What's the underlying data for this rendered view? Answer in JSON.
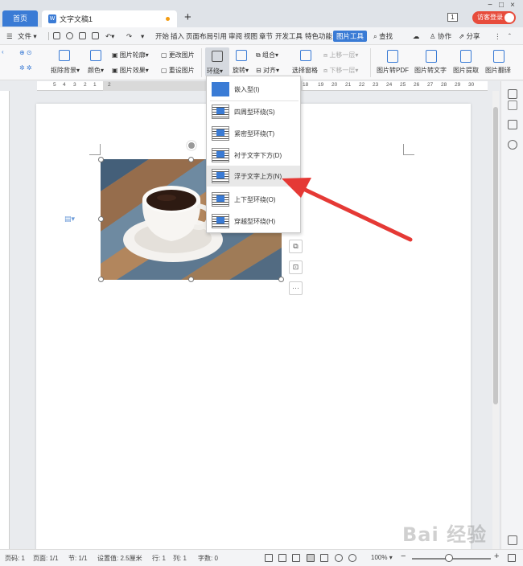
{
  "titlebar": {
    "home_tab": "首页",
    "doc_tab": "文字文稿1",
    "add_tab": "+",
    "page_count": "1",
    "login": "访客登录",
    "win_controls": [
      "−",
      "□",
      "×"
    ]
  },
  "menubar": {
    "file": "文件",
    "items": [
      "开始",
      "插入",
      "页面布局",
      "引用",
      "审阅",
      "视图",
      "章节",
      "开发工具",
      "特色功能"
    ],
    "active": "图片工具",
    "search": "查找",
    "collab": "协作",
    "share": "分享"
  },
  "ribbon": {
    "remove_bg": "抠除背景",
    "color": "颜色",
    "pic_outline": "图片轮廓",
    "pic_effect": "图片效果",
    "change_pic": "更改图片",
    "reset_pic": "重设图片",
    "wrap": "环绕",
    "rotate": "旋转",
    "group": "组合",
    "align": "对齐",
    "select_pane": "选择窗格",
    "bring_forward": "上移一层",
    "send_backward": "下移一层",
    "pic_to_pdf": "图片转PDF",
    "pic_to_text": "图片转文字",
    "pic_extract": "图片提取",
    "pic_translate": "图片翻译"
  },
  "ruler": {
    "left_numbers": [
      "5",
      "4",
      "3",
      "2",
      "1"
    ],
    "right_numbers": [
      "18",
      "19",
      "20",
      "21",
      "22",
      "23",
      "24",
      "25",
      "26",
      "27",
      "28",
      "29",
      "30",
      "31",
      "32",
      "33"
    ],
    "sel_start": "2",
    "sel_end": "16"
  },
  "wrap_menu": {
    "items": [
      {
        "label": "嵌入型(I)"
      },
      {
        "label": "四周型环绕(S)"
      },
      {
        "label": "紧密型环绕(T)"
      },
      {
        "label": "衬于文字下方(D)"
      },
      {
        "label": "浮于文字上方(N)",
        "highlighted": true
      },
      {
        "label": "上下型环绕(O)"
      },
      {
        "label": "穿越型环绕(H)"
      }
    ]
  },
  "side_tools": [
    "layout-options",
    "crop",
    "more"
  ],
  "side_tool_more": "···",
  "statusbar": {
    "page_num": "页码: 1",
    "pages": "页面: 1/1",
    "section": "节: 1/1",
    "setting": "设置值: 2.5厘米",
    "row": "行: 1",
    "col": "列: 1",
    "words": "字数: 0",
    "zoom": "100%",
    "zoom_minus": "−",
    "zoom_plus": "+"
  },
  "zoom_level": 1.0,
  "watermark": "Bai 经验",
  "colors": {
    "accent": "#3a7bd5",
    "arrow": "#e53935",
    "login": "#e74c3c"
  }
}
